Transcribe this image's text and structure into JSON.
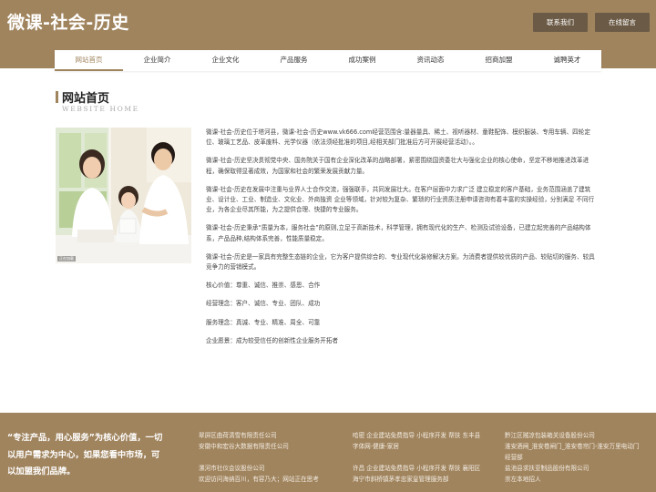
{
  "header": {
    "site_title": "微课-社会-历史",
    "contact_button": "联系我们",
    "message_button": "在线留言"
  },
  "nav": {
    "items": [
      "网站首页",
      "企业简介",
      "企业文化",
      "产品服务",
      "成功案例",
      "资讯动态",
      "招商加盟",
      "诚聘英才"
    ],
    "active_index": 0
  },
  "section": {
    "title": "网站首页",
    "subtitle": "WEBSITE HOME"
  },
  "photo": {
    "alt": "family photo",
    "badge": "正在加载"
  },
  "content": {
    "paragraphs": [
      "微课-社会-历史位于塔河县，微课-社会-历史www.vk666.com经营范围含:量器量具、稀土、视听器材、童鞋配饰、模织服装、专用车辆、四轮定位、玻璃工艺品、皮革废料、光学仪器（依法须经批准的项目,经相关部门批准后方可开展经营活动）。。",
      "微课-社会-历史坚决贯彻党中央、国务院关于国有企业深化改革的战略部署，紧密围绕国资委壮大与强化企业的核心使命，坚定不移地推进改革进程，确保取得显著成效，为国家和社会的繁荣发展贡献力量。",
      "微课-社会-历史在发展中注重与业界人士合作交流，强强联手，共同发展壮大。在客户层面中力求广泛 建立稳定的客户基础，业务范围涵盖了建筑业、设计业、工业、制造业、文化业、外商独资 企业等领域，针对较为复杂、繁琐的行业资质注册申请咨询有着丰富的实操经验，分别满足 不同行业，为各企业尽其所能，为之提供合理、快捷的专业服务。",
      "微课-社会-历史秉承“质量为本，服务社会”的原则,立足于高新技术，科学管理，拥有现代化的生产、检测及试验设备，已建立起完善的产品结构体系，产品品种,结构体系完善，性能质量稳定。",
      "微课-社会-历史是一家具有完整生态链的企业，它为客户提供综合的、专业现代化装修解决方案。为消费者提供较优质的产品、较贴切的服务、较具竞争力的营销模式。",
      "核心价值：尊重、诚信、推崇、感恩、合作",
      "经营理念：客户、诚信、专业、团队、成功",
      "服务理念：真诚、专业、精准、周全、可靠",
      "企业愿景：成为较受信任的创新性企业服务开拓者"
    ]
  },
  "footer": {
    "slogan": "“专注产品，用心服务”为核心价值，一切以用户需求为中心，如果您看中市场，可以加盟我们品牌。",
    "col1": [
      "翠屏区曲荷清雪有限责任公司",
      "安徽中和宏谷大数据有限责任公司",
      "",
      "漯河市社仪会议股份公司",
      "欢迎访问海纳百川，有容乃大；网站正在思考"
    ],
    "col2": [
      "哈密 企业建站免费指导 小程序开发 帮扶 东丰县",
      "字体网-健康-家居",
      "",
      "许昌 企业建站免费指导 小程序开发 帮扶 襄阳区",
      "海宁市斜桥镇茅孝忠家皇管理服务部"
    ],
    "col3": [
      "黔江区贼凉包装箱关设备股份公司",
      "淮安酒闸_淮安卷闸门_淮安卷帘门-淮安万里电动门",
      "经营部",
      "盐池县求扶亚制品股份有限公司",
      "崇左本地招人"
    ]
  }
}
